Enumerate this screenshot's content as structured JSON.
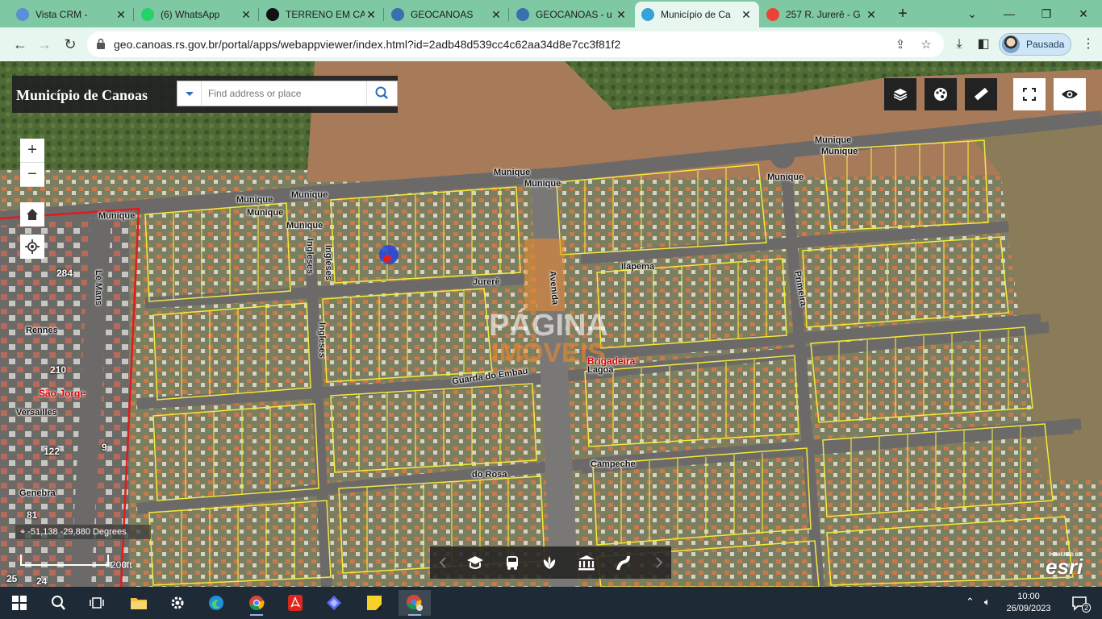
{
  "browser": {
    "tabs": [
      {
        "title": "Vista CRM -",
        "icon": "crm-icon",
        "color": "#5b8fd6"
      },
      {
        "title": "(6) WhatsApp",
        "icon": "whatsapp-icon",
        "color": "#25d366"
      },
      {
        "title": "TERRENO EM CA",
        "icon": "dark-triangle-icon",
        "color": "#111111"
      },
      {
        "title": "GEOCANOAS",
        "icon": "globe-icon",
        "color": "#3a6fb0"
      },
      {
        "title": "GEOCANOAS - u",
        "icon": "globe-icon",
        "color": "#3a6fb0"
      },
      {
        "title": "Município de Ca",
        "icon": "arcgis-icon",
        "color": "#35a3d8",
        "active": true
      },
      {
        "title": "257 R. Jurerê - G",
        "icon": "maps-pin-icon",
        "color": "#ea4335"
      }
    ],
    "url": "geo.canoas.rs.gov.br/portal/apps/webappviewer/index.html?id=2adb48d539cc4c62aa34d8e7cc3f81f2",
    "profile_label": "Pausada"
  },
  "app": {
    "title": "Município de Canoas",
    "search_placeholder": "Find address or place",
    "coordinates": "-51,138 -29,880 Degrees",
    "scale_label": "200ft",
    "esri_powered": "POWERED BY",
    "esri_logo": "esri"
  },
  "map_labels": {
    "roads": [
      "Munique",
      "Munique",
      "Munique",
      "Munique",
      "Munique",
      "Munique",
      "Munique",
      "Munique",
      "Munique",
      "Munique",
      "Ingleses",
      "Ingleses",
      "Ingleses",
      "Jurerê",
      "Ilapema",
      "Primeira",
      "Guarda do Embaú",
      "do Rosa",
      "Campeche",
      "Rennes",
      "Versailles",
      "Genebra",
      "Lé Mans",
      "Avenida",
      "Lagoa"
    ],
    "lots": [
      "284",
      "210",
      "122",
      "81",
      "9",
      "25",
      "24"
    ],
    "red": [
      "São Jorge",
      "Brigadeira"
    ]
  },
  "taskbar": {
    "time": "10:00",
    "date": "26/09/2023",
    "notifications": "2"
  }
}
